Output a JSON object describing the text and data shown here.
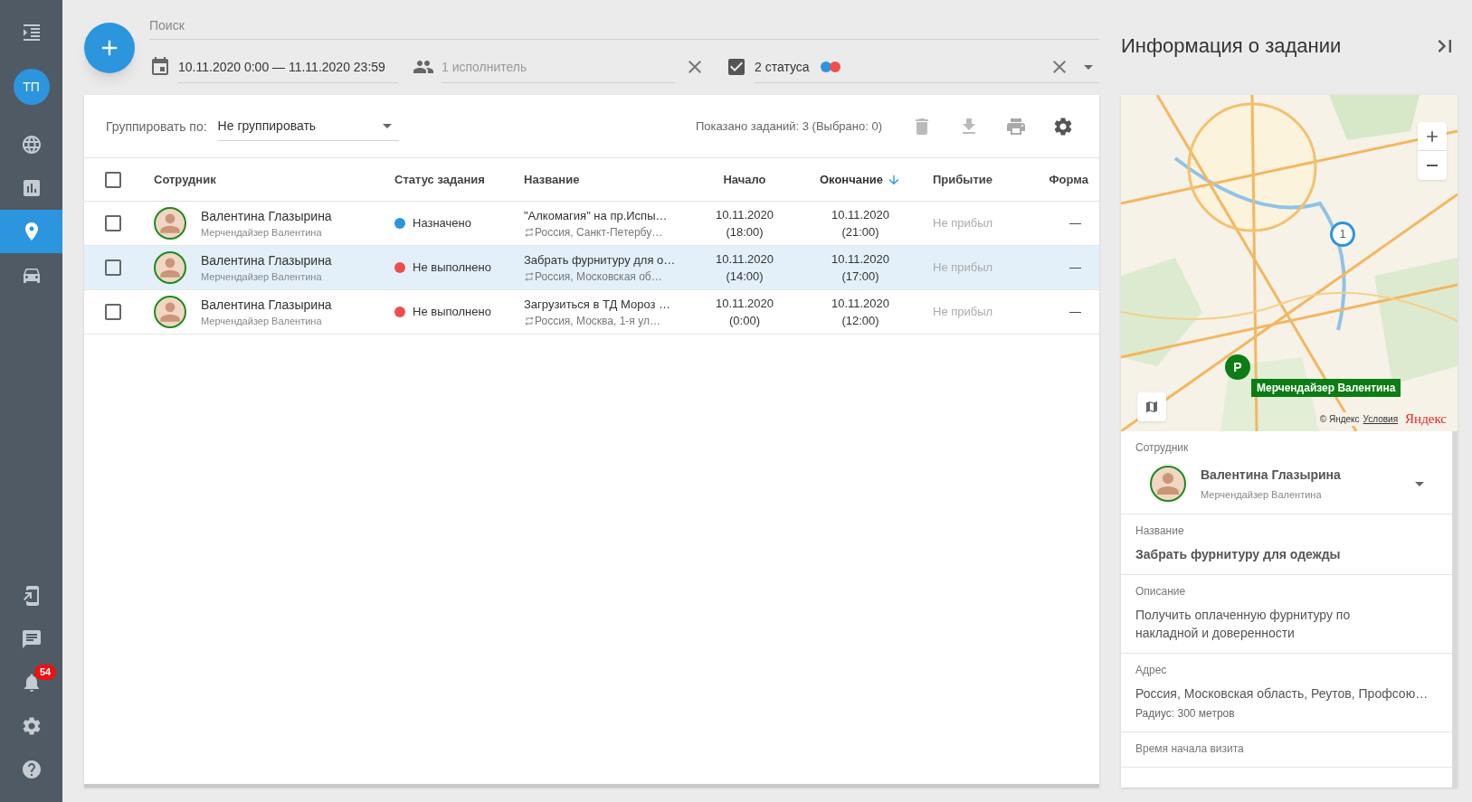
{
  "sidebar": {
    "avatar": "ТП",
    "items": [
      {
        "kind": "globe",
        "selected": false
      },
      {
        "kind": "chart",
        "selected": false
      },
      {
        "kind": "pin",
        "selected": true
      },
      {
        "kind": "car",
        "selected": false
      }
    ],
    "bottom_items": [
      {
        "kind": "login"
      },
      {
        "kind": "chat"
      },
      {
        "kind": "bell",
        "badge": "54"
      },
      {
        "kind": "settings"
      },
      {
        "kind": "help"
      }
    ]
  },
  "filters": {
    "search_placeholder": "Поиск",
    "date_range": "10.11.2020 0:00 — 11.11.2020 23:59",
    "executors": "1 исполнитель",
    "status": {
      "checked": true,
      "label": "2 статуса",
      "dots": [
        {
          "color": "#2b95de"
        },
        {
          "color": "#ef4e4e"
        }
      ]
    }
  },
  "toolbar": {
    "group_label": "Группировать по:",
    "group_value": "Не группировать",
    "shown": "Показано заданий: 3 (Выбрано: 0)"
  },
  "table": {
    "select_all": false,
    "columns": [
      {
        "label": "Сотрудник",
        "sorted": false
      },
      {
        "label": "Статус задания",
        "sorted": false
      },
      {
        "label": "Название",
        "sorted": false
      },
      {
        "label": "Начало",
        "sorted": false
      },
      {
        "label": "Окончание",
        "sorted": true
      },
      {
        "label": "Прибытие",
        "sorted": false
      },
      {
        "label": "Форма",
        "sorted": false
      }
    ],
    "rows": [
      {
        "checked": false,
        "selected": false,
        "name": "Валентина Глазырина",
        "role": "Мерчендайзер Валентина",
        "status": "Назначено",
        "color": "#2b95de",
        "title": "\"Алкомагия\" на пр.Испы…",
        "address": "Россия, Санкт-Петербу…",
        "start_date": "10.11.2020",
        "start_time": "(18:00)",
        "end_date": "10.11.2020",
        "end_time": "(21:00)",
        "arrival": "Не прибыл",
        "form": "—"
      },
      {
        "checked": false,
        "selected": true,
        "name": "Валентина Глазырина",
        "role": "Мерчендайзер Валентина",
        "status": "Не выполнено",
        "color": "#ef4e4e",
        "title": "Забрать фурнитуру для о…",
        "address": "Россия, Московская об…",
        "start_date": "10.11.2020",
        "start_time": "(14:00)",
        "end_date": "10.11.2020",
        "end_time": "(17:00)",
        "arrival": "Не прибыл",
        "form": "—"
      },
      {
        "checked": false,
        "selected": false,
        "name": "Валентина Глазырина",
        "role": "Мерчендайзер Валентина",
        "status": "Не выполнено",
        "color": "#ef4e4e",
        "title": "Загрузиться в ТД Мороз …",
        "address": "Россия, Москва, 1-я ул…",
        "start_date": "10.11.2020",
        "start_time": "(0:00)",
        "end_date": "10.11.2020",
        "end_time": "(12:00)",
        "arrival": "Не прибыл",
        "form": "—"
      }
    ]
  },
  "info_panel": {
    "title": "Информация о задании",
    "map": {
      "marker": "1",
      "person_marker": "P",
      "person_label": "Мерчендайзер Валентина",
      "copyright": "© Яндекс",
      "terms": "Условия",
      "logo": "Яндекс"
    },
    "employee": {
      "label": "Сотрудник",
      "name": "Валентина Глазырина",
      "role": "Мерчендайзер Валентина"
    },
    "fields": [
      {
        "label": "Название",
        "value": "Забрать фурнитуру для одежды"
      },
      {
        "label": "Описание",
        "value": "Получить оплаченную фурнитуру по накладной и доверенности"
      },
      {
        "label": "Адрес",
        "value": "Россия, Московская область, Реутов, Профсою…",
        "note": "Радиус: 300 метров"
      },
      {
        "label": "Время начала визита"
      }
    ]
  }
}
